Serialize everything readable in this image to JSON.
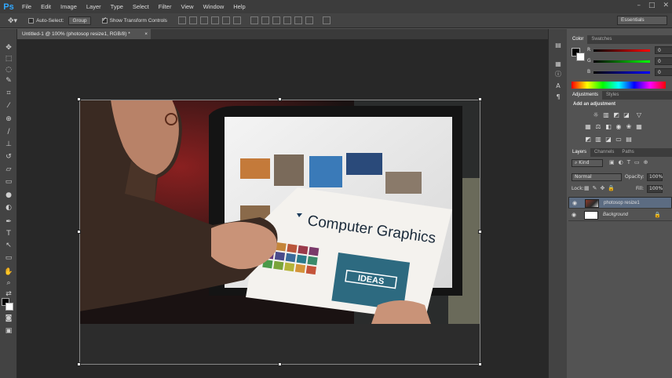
{
  "app": {
    "logo": "Ps"
  },
  "menu": [
    "File",
    "Edit",
    "Image",
    "Layer",
    "Type",
    "Select",
    "Filter",
    "View",
    "Window",
    "Help"
  ],
  "window_controls": [
    "–",
    "□",
    "✕"
  ],
  "options": {
    "auto_select_label": "Auto-Select:",
    "auto_select_value": "Group",
    "show_transform_label": "Show Transform Controls",
    "workspace": "Essentials"
  },
  "document": {
    "tab_title": "Untitled-1 @ 100% (photosop resize1, RGB/8) *"
  },
  "photo": {
    "card_title": "Computer Graphics",
    "badge_text": "IDEAS"
  },
  "color_panel": {
    "tabs": [
      "Color",
      "Swatches"
    ],
    "rows": [
      {
        "label": "R",
        "value": "0"
      },
      {
        "label": "G",
        "value": "0"
      },
      {
        "label": "B",
        "value": "0"
      }
    ]
  },
  "adjustments_panel": {
    "tabs": [
      "Adjustments",
      "Styles"
    ],
    "heading": "Add an adjustment"
  },
  "layers_panel": {
    "tabs": [
      "Layers",
      "Channels",
      "Paths"
    ],
    "filter": "Kind",
    "blend_mode": "Normal",
    "opacity_label": "Opacity:",
    "opacity_value": "100%",
    "lock_label": "Lock:",
    "fill_label": "Fill:",
    "fill_value": "100%",
    "layers": [
      {
        "name": "photosop resize1",
        "selected": true
      },
      {
        "name": "Background",
        "selected": false
      }
    ]
  },
  "colors": {
    "accent": "#31a8ff",
    "selected_layer": "#5c6c82"
  }
}
